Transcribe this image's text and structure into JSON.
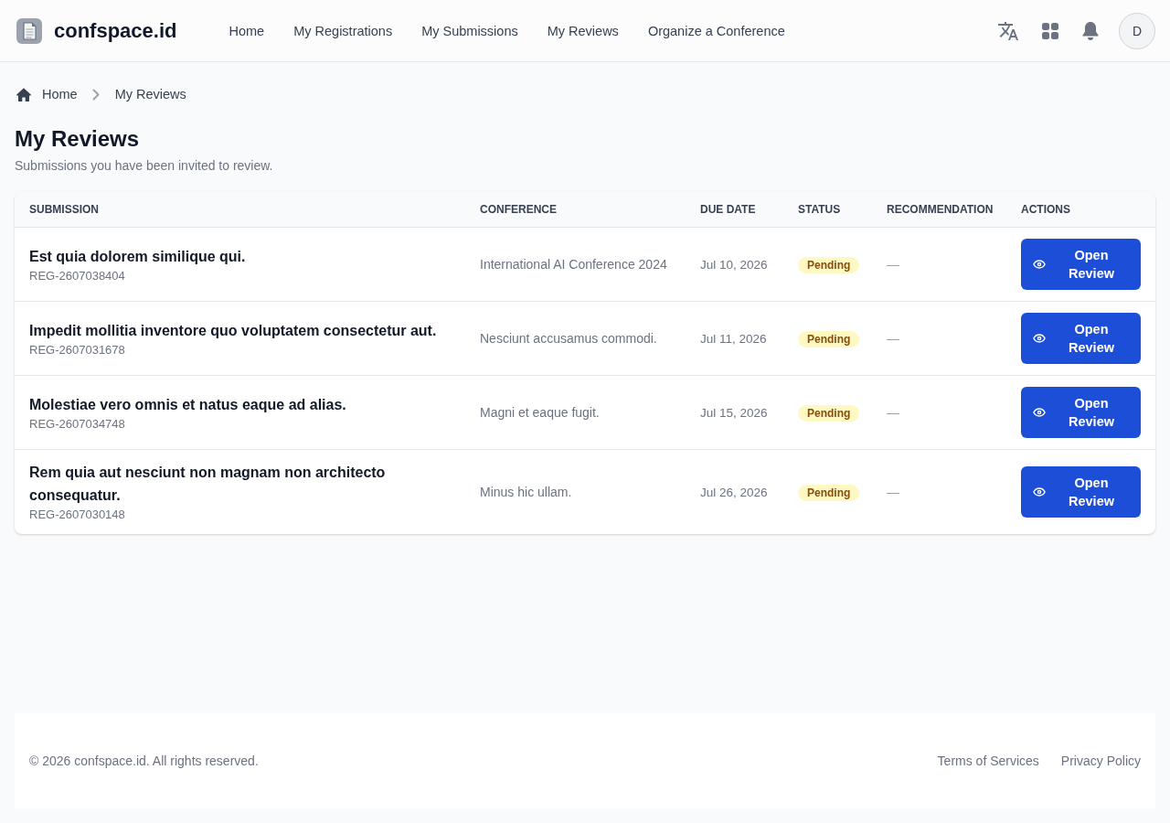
{
  "header": {
    "brand": "confspace.id",
    "nav": [
      "Home",
      "My Registrations",
      "My Submissions",
      "My Reviews",
      "Organize a Conference"
    ],
    "avatar": "D"
  },
  "breadcrumb": [
    "Home",
    "My Reviews"
  ],
  "page": {
    "title": "My Reviews",
    "subtitle": "Submissions you have been invited to review."
  },
  "table": {
    "columns": [
      "SUBMISSION",
      "CONFERENCE",
      "DUE DATE",
      "STATUS",
      "RECOMMENDATION",
      "ACTIONS"
    ],
    "rows": [
      {
        "title": "Est quia dolorem similique qui.",
        "code": "REG-2607038404",
        "conference": "International AI Conference 2024",
        "due_date": "Jul 10, 2026",
        "status": "Pending",
        "recommendation": "—",
        "action": "Open Review"
      },
      {
        "title": "Impedit mollitia inventore quo voluptatem consectetur aut.",
        "code": "REG-2607031678",
        "conference": "Nesciunt accusamus commodi.",
        "due_date": "Jul 11, 2026",
        "status": "Pending",
        "recommendation": "—",
        "action": "Open Review"
      },
      {
        "title": "Molestiae vero omnis et natus eaque ad alias.",
        "code": "REG-2607034748",
        "conference": "Magni et eaque fugit.",
        "due_date": "Jul 15, 2026",
        "status": "Pending",
        "recommendation": "—",
        "action": "Open Review"
      },
      {
        "title": "Rem quia aut nesciunt non magnam non architecto consequatur.",
        "code": "REG-2607030148",
        "conference": "Minus hic ullam.",
        "due_date": "Jul 26, 2026",
        "status": "Pending",
        "recommendation": "—",
        "action": "Open Review"
      }
    ]
  },
  "footer": {
    "copyright": "© 2026 confspace.id. All rights reserved.",
    "links": [
      "Terms of Services",
      "Privacy Policy"
    ]
  }
}
